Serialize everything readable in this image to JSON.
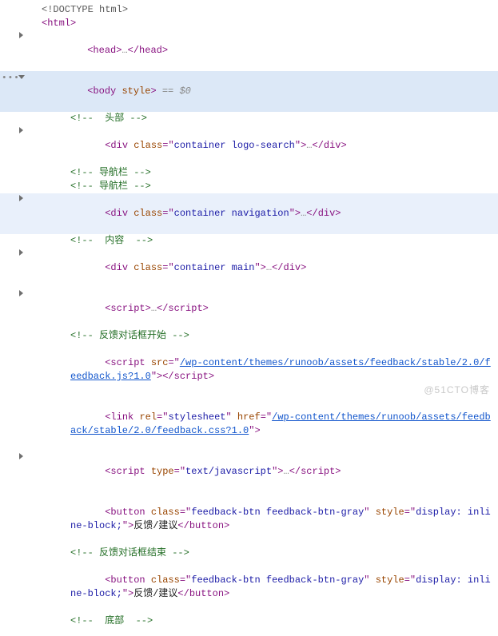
{
  "watermark": "@51CTO博客",
  "doctype": "<!DOCTYPE html>",
  "html_open": "<html>",
  "head_line": {
    "open": "<head>",
    "ell": "…",
    "close": "</head>"
  },
  "body_line": {
    "open": "<body ",
    "attr": "style",
    "close": ">",
    "eq": " == ",
    "dollar": "$0"
  },
  "comments": {
    "header": "<!--  头部 -->",
    "nav1": "<!-- 导航栏 -->",
    "nav2": "<!-- 导航栏 -->",
    "content": "<!--  内容  -->",
    "feedback_start": "<!-- 反馈对话框开始 -->",
    "feedback_end": "<!-- 反馈对话框结束 -->",
    "footer": "<!--  底部  -->"
  },
  "divs": {
    "logo": {
      "tag": "div",
      "cls": "container logo-search"
    },
    "nav": {
      "tag": "div",
      "cls": "container navigation"
    },
    "main": {
      "tag": "div",
      "cls": "container main"
    }
  },
  "script_plain": {
    "open": "<script>",
    "ell": "…",
    "close": "</script>"
  },
  "script_src": {
    "open": "<script ",
    "attr": "src",
    "q": "\"",
    "url": "/wp-content/themes/runoob/assets/feedback/stable/2.0/feedback.js?1.0",
    "close": "></script>"
  },
  "link": {
    "open": "<link ",
    "rel_attr": "rel",
    "rel_val": "stylesheet",
    "href_attr": "href",
    "href_val": "/wp-content/themes/runoob/assets/feedback/stable/2.0/feedback.css?1.0",
    "close": ">"
  },
  "script_type": {
    "open": "<script ",
    "attr": "type",
    "val": "text/javascript",
    "close": ">",
    "ell": "…",
    "end": "</script>"
  },
  "button": {
    "open": "<button ",
    "cls_attr": "class",
    "cls_val": "feedback-btn feedback-btn-gray",
    "style_attr": "style",
    "style_val": "display: inline-block;",
    "close": ">",
    "text": "反馈/建议",
    "end": "</button>"
  },
  "padding": {
    "p0": "8px",
    "p1": "22px",
    "p2": "44px"
  }
}
